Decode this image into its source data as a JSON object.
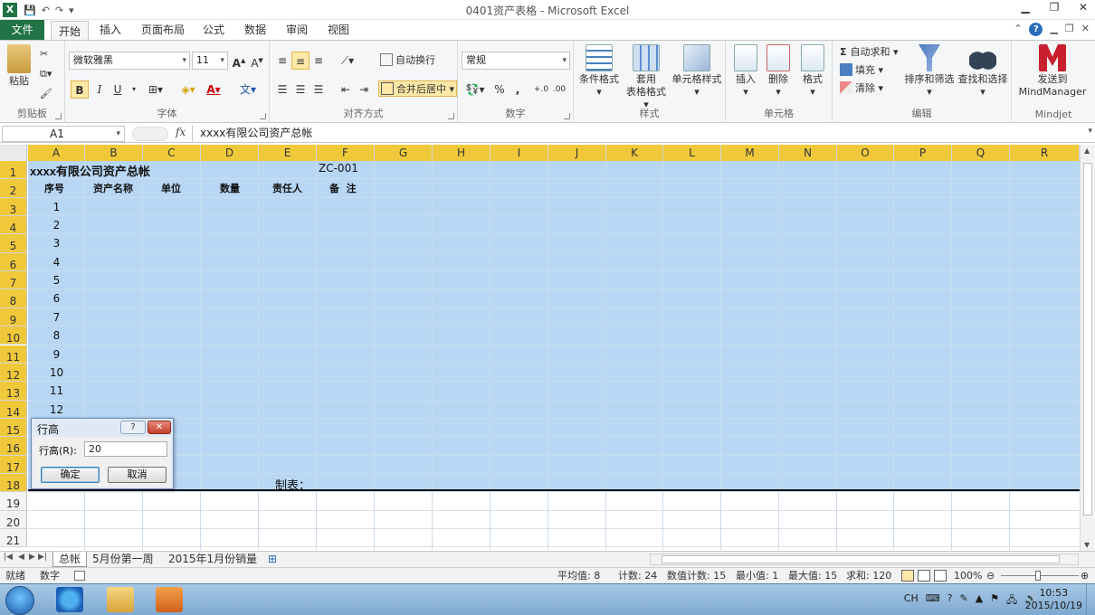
{
  "titlebar": {
    "app_icon": "X",
    "title": "0401资产表格 - Microsoft Excel",
    "qat_icons": [
      "save-icon",
      "undo-icon",
      "redo-icon",
      "customize-icon"
    ]
  },
  "tabs": {
    "file": "文件",
    "items": [
      "开始",
      "插入",
      "页面布局",
      "公式",
      "数据",
      "审阅",
      "视图"
    ],
    "active": "开始"
  },
  "ribbon": {
    "clipboard": {
      "label": "剪贴板",
      "paste": "粘贴"
    },
    "font": {
      "label": "字体",
      "font_name": "微软雅黑",
      "font_size": "11",
      "bold": "B",
      "italic": "I",
      "underline": "U"
    },
    "alignment": {
      "label": "对齐方式",
      "wrap": "自动换行",
      "merge": "合并后居中"
    },
    "number": {
      "label": "数字",
      "format": "常规",
      "percent": "%",
      "comma": ","
    },
    "styles": {
      "label": "样式",
      "conditional": "条件格式",
      "table_line1": "套用",
      "table_line2": "表格格式",
      "cell_styles": "单元格样式"
    },
    "cells": {
      "label": "单元格",
      "insert": "插入",
      "delete": "删除",
      "format": "格式"
    },
    "editing": {
      "label": "编辑",
      "autosum": "自动求和",
      "fill": "填充",
      "clear": "清除",
      "sort": "排序和筛选",
      "find": "查找和选择"
    },
    "mindjet": {
      "label": "Mindjet",
      "send_line1": "发送到",
      "send_line2": "MindManager"
    }
  },
  "formula_bar": {
    "name_box": "A1",
    "fx": "fx",
    "content": "xxxx有限公司资产总帐"
  },
  "grid": {
    "columns": [
      "A",
      "B",
      "C",
      "D",
      "E",
      "F",
      "G",
      "H",
      "I",
      "J",
      "K",
      "L",
      "M",
      "N",
      "O",
      "P",
      "Q",
      "R"
    ],
    "rows": [
      "1",
      "2",
      "3",
      "4",
      "5",
      "6",
      "7",
      "8",
      "9",
      "10",
      "11",
      "12",
      "13",
      "14",
      "15",
      "16",
      "17",
      "18",
      "19",
      "20",
      "21"
    ],
    "cells": {
      "A1": "xxxx有限公司资产总帐",
      "F1": "ZC-001",
      "A2": "序号",
      "B2": "资产名称",
      "C2": "单位",
      "D2": "数量",
      "E2": "责任人",
      "F2": "备  注",
      "E18": "制表："
    },
    "serials": [
      "1",
      "2",
      "3",
      "4",
      "5",
      "6",
      "7",
      "8",
      "9",
      "10",
      "11",
      "12"
    ]
  },
  "dialog": {
    "title": "行高",
    "help": "?",
    "close": "✕",
    "label": "行高(R):",
    "value": "20",
    "ok": "确定",
    "cancel": "取消"
  },
  "sheet_tabs": {
    "items": [
      "总帐",
      "5月份第一周",
      "2015年1月份销量"
    ],
    "active": "总帐"
  },
  "status": {
    "ready": "就绪",
    "mode": "数字",
    "average": "平均值: 8",
    "count": "计数: 24",
    "numcount": "数值计数: 15",
    "min": "最小值: 1",
    "max": "最大值: 15",
    "sum": "求和: 120",
    "zoom": "100%"
  },
  "taskbar": {
    "apps": [
      "ie-icon",
      "explorer-icon",
      "media-player-icon"
    ],
    "lang": "CH",
    "time": "10:53",
    "date": "2015/10/19"
  }
}
